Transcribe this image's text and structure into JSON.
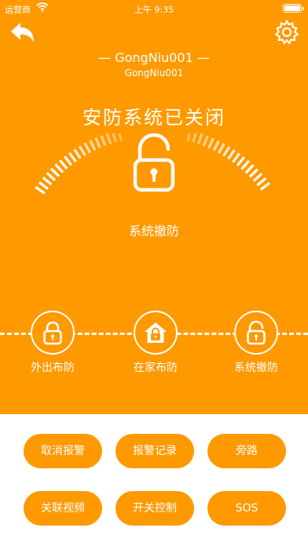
{
  "status_bar": {
    "carrier": "运营商",
    "time": "上午 9:35"
  },
  "header": {
    "back_icon": "back-arrow-icon",
    "settings_icon": "gear-icon"
  },
  "device": {
    "name": "— GongNiu001 —",
    "id": "GongNiu001"
  },
  "status": {
    "title": "安防系统已关闭",
    "current_mode": "系统撤防",
    "lock_icon": "unlock-icon"
  },
  "modes": [
    {
      "label": "外出布防",
      "icon": "lock-icon"
    },
    {
      "label": "在家布防",
      "icon": "home-lock-icon"
    },
    {
      "label": "系统撤防",
      "icon": "unlock-icon"
    }
  ],
  "actions": [
    {
      "label": "取消报警"
    },
    {
      "label": "报警记录"
    },
    {
      "label": "旁路"
    },
    {
      "label": "关联视频"
    },
    {
      "label": "开关控制"
    },
    {
      "label": "SOS"
    }
  ],
  "colors": {
    "primary": "#FF9900",
    "white": "#FFFFFF"
  }
}
